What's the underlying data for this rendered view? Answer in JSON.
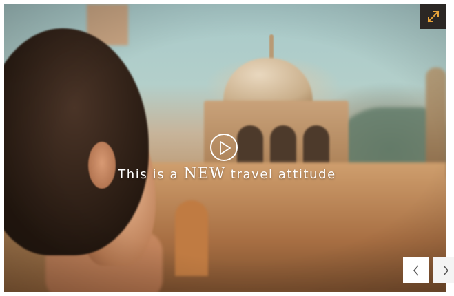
{
  "video": {
    "tagline_start": "This is a",
    "tagline_emphasis": "NEW",
    "tagline_end": "travel attitude"
  },
  "controls": {
    "play_icon": "play-icon",
    "expand_icon": "expand-icon",
    "prev_icon": "chevron-left-icon",
    "next_icon": "chevron-right-icon"
  },
  "colors": {
    "expand_button_bg": "#2b2724",
    "expand_icon_color": "#e8a43a",
    "nav_button_bg": "#ffffff",
    "nav_icon_color": "#555555"
  }
}
